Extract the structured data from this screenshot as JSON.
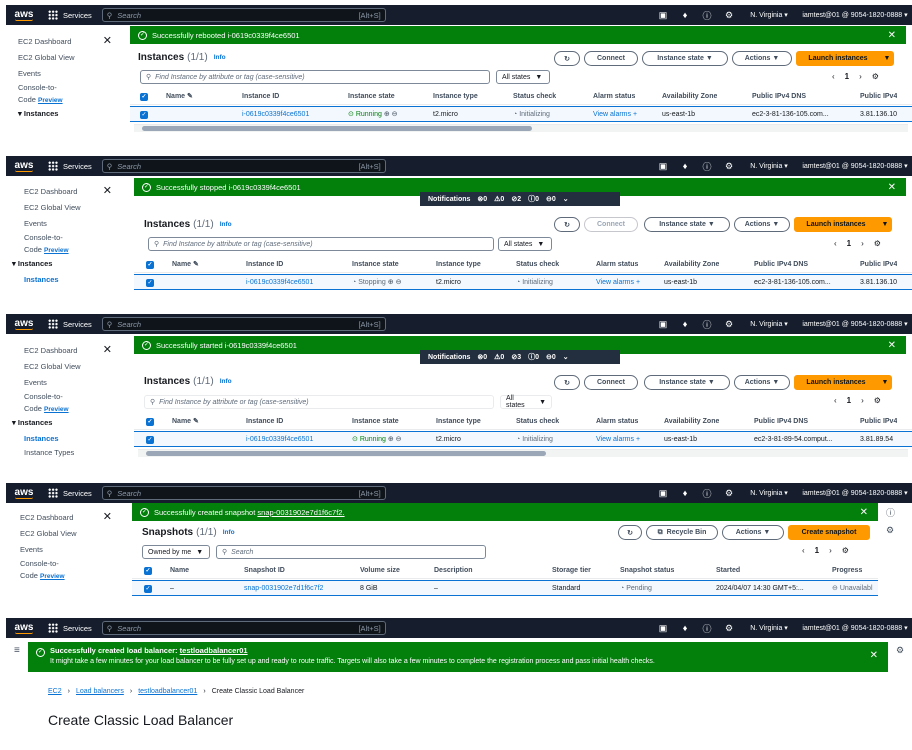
{
  "nav": {
    "logo": "aws",
    "services": "Services",
    "search_placeholder": "Search",
    "shortcut": "[Alt+S]",
    "region": "N. Virginia ▾",
    "account": "iamtest@01 @ 9054-1820-0888 ▾"
  },
  "panel1": {
    "sidebar": [
      "EC2 Dashboard",
      "EC2 Global View",
      "Events",
      "Console-to-",
      "Code",
      "Preview",
      "Instances"
    ],
    "flash": "Successfully rebooted i-0619c0339f4ce6501",
    "title": "Instances",
    "count": "(1/1)",
    "info": "Info",
    "buttons": {
      "refresh": "↻",
      "connect": "Connect",
      "state": "Instance state ▼",
      "actions": "Actions ▼",
      "launch": "Launch instances",
      "caret": "▼"
    },
    "filter_placeholder": "Find Instance by attribute or tag (case-sensitive)",
    "states": "All states",
    "page": "1",
    "columns": [
      "Name",
      "Instance ID",
      "Instance state",
      "Instance type",
      "Status check",
      "Alarm status",
      "Availability Zone",
      "Public IPv4 DNS",
      "Public IPv4"
    ],
    "row": {
      "id": "i-0619c0339f4ce6501",
      "state": "Running",
      "type": "t2.micro",
      "status": "Initializing",
      "alarm": "View alarms +",
      "az": "us-east-1b",
      "dns": "ec2-3-81-136-105.com...",
      "ip": "3.81.136.10"
    }
  },
  "panel2": {
    "sidebar": [
      "EC2 Dashboard",
      "EC2 Global View",
      "Events",
      "Console-to-",
      "Code",
      "Preview",
      "Instances",
      "Instances"
    ],
    "flash": "Successfully stopped i-0619c0339f4ce6501",
    "notifications": "Notifications",
    "notif_counts": [
      "⊗0",
      "⚠0",
      "⊘2",
      "ⓘ0",
      "⊖0"
    ],
    "title": "Instances",
    "count": "(1/1)",
    "info": "Info",
    "buttons": {
      "refresh": "↻",
      "connect": "Connect",
      "state": "Instance state ▼",
      "actions": "Actions ▼",
      "launch": "Launch instances",
      "caret": "▼"
    },
    "filter_placeholder": "Find Instance by attribute or tag (case-sensitive)",
    "states": "All states",
    "page": "1",
    "columns": [
      "Name",
      "Instance ID",
      "Instance state",
      "Instance type",
      "Status check",
      "Alarm status",
      "Availability Zone",
      "Public IPv4 DNS",
      "Public IPv4"
    ],
    "row": {
      "id": "i-0619c0339f4ce6501",
      "state": "Stopping",
      "type": "t2.micro",
      "status": "Initializing",
      "alarm": "View alarms +",
      "az": "us-east-1b",
      "dns": "ec2-3-81-136-105.com...",
      "ip": "3.81.136.10"
    }
  },
  "panel3": {
    "sidebar": [
      "EC2 Dashboard",
      "EC2 Global View",
      "Events",
      "Console-to-",
      "Code",
      "Preview",
      "Instances",
      "Instances",
      "Instance Types"
    ],
    "flash": "Successfully started i-0619c0339f4ce6501",
    "notifications": "Notifications",
    "notif_counts": [
      "⊗0",
      "⚠0",
      "⊘3",
      "ⓘ0",
      "⊖0"
    ],
    "title": "Instances",
    "count": "(1/1)",
    "info": "Info",
    "buttons": {
      "refresh": "↻",
      "connect": "Connect",
      "state": "Instance state ▼",
      "actions": "Actions ▼",
      "launch": "Launch instances",
      "caret": "▼"
    },
    "filter_placeholder": "Find Instance by attribute or tag (case-sensitive)",
    "states": "All states",
    "page": "1",
    "columns": [
      "Name",
      "Instance ID",
      "Instance state",
      "Instance type",
      "Status check",
      "Alarm status",
      "Availability Zone",
      "Public IPv4 DNS",
      "Public IPv4"
    ],
    "row": {
      "id": "i-0619c0339f4ce6501",
      "state": "Running",
      "type": "t2.micro",
      "status": "Initializing",
      "alarm": "View alarms +",
      "az": "us-east-1b",
      "dns": "ec2-3-81-89-54.comput...",
      "ip": "3.81.89.54"
    }
  },
  "panel4": {
    "sidebar": [
      "EC2 Dashboard",
      "EC2 Global View",
      "Events",
      "Console-to-",
      "Code",
      "Preview"
    ],
    "flash_prefix": "Successfully created snapshot",
    "flash_link": "snap-0031902e7d1f6c7f2.",
    "title": "Snapshots",
    "count": "(1/1)",
    "info": "Info",
    "buttons": {
      "refresh": "↻",
      "recycle": "Recycle Bin",
      "actions": "Actions ▼",
      "create": "Create snapshot"
    },
    "owned": "Owned by me",
    "search_placeholder": "Search",
    "page": "1",
    "columns": [
      "Name",
      "Snapshot ID",
      "Volume size",
      "Description",
      "Storage tier",
      "Snapshot status",
      "Started",
      "Progress"
    ],
    "row": {
      "name": "–",
      "id": "snap-0031902e7d1f6c7f2",
      "size": "8 GiB",
      "desc": "–",
      "tier": "Standard",
      "status": "Pending",
      "started": "2024/04/07 14:30 GMT+5:...",
      "progress": "Unavailabl"
    }
  },
  "panel5": {
    "flash_prefix": "Successfully created load balancer:",
    "flash_link": "testloadbalancer01",
    "flash_sub": "It might take a few minutes for your load balancer to be fully set up and ready to route traffic. Targets will also take a few minutes to complete the registration process and pass initial health checks.",
    "breadcrumb": [
      "EC2",
      "Load balancers",
      "testloadbalancer01",
      "Create Classic Load Balancer"
    ],
    "heading": "Create Classic Load Balancer"
  }
}
